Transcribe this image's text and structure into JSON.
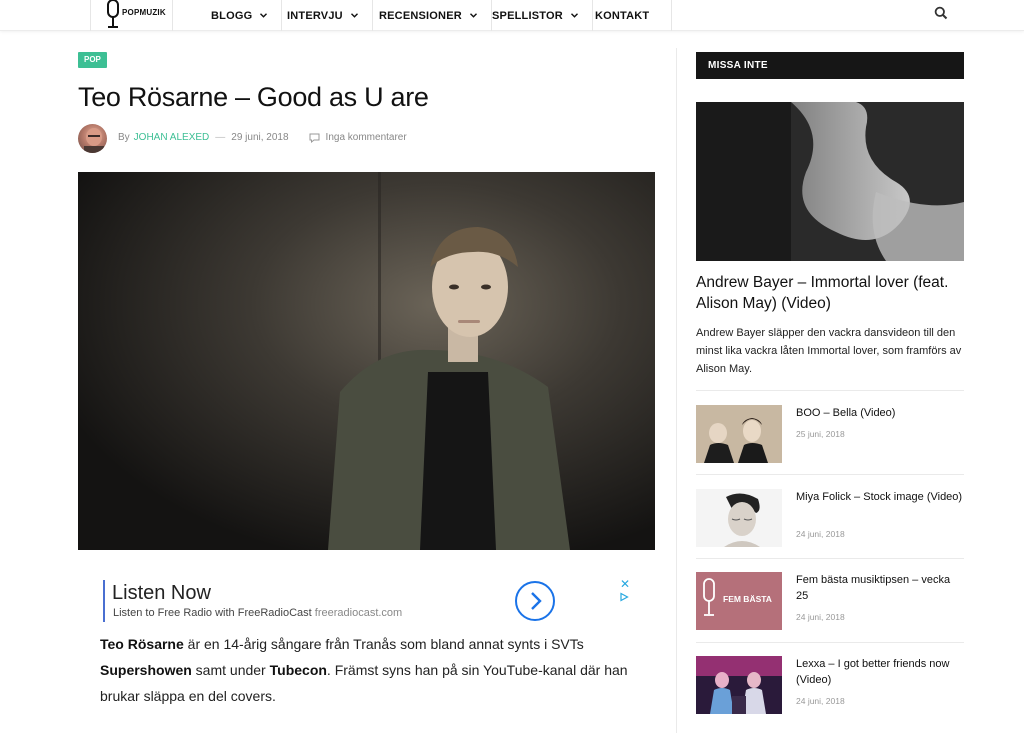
{
  "site": {
    "logo_text": "POPMUZIK"
  },
  "nav": {
    "items": [
      {
        "label": "BLOGG"
      },
      {
        "label": "INTERVJU"
      },
      {
        "label": "RECENSIONER"
      },
      {
        "label": "SPELLISTOR"
      },
      {
        "label": "KONTAKT"
      }
    ]
  },
  "article": {
    "category": "POP",
    "title": "Teo Rösarne – Good as U are",
    "by": "By",
    "author": "JOHAN ALEXED",
    "date": "29 juni, 2018",
    "comments": "Inga kommentarer",
    "body": {
      "s1_name": "Teo Rösarne",
      "s1_text": " är en 14-årig sångare från Tranås som bland annat synts i SVTs ",
      "s1_show": "Supershowen",
      "s1_mid": " samt under ",
      "s1_event": "Tubecon",
      "s1_end": ". Främst syns han på sin YouTube-kanal där han brukar släppa en del covers."
    }
  },
  "ad": {
    "title": "Listen Now",
    "subtitle": "Listen to Free Radio with FreeRadioCast",
    "domain": "freeradiocast.com",
    "close": "✕"
  },
  "sidebar": {
    "heading": "MISSA INTE",
    "featured": {
      "title": "Andrew Bayer – Immortal lover (feat. Alison May) (Video)",
      "description": "Andrew Bayer släpper den vackra dansvideon till den minst lika vackra låten Immortal lover, som framförs av Alison May."
    },
    "items": [
      {
        "title": "BOO – Bella (Video)",
        "date": "25 juni, 2018"
      },
      {
        "title": "Miya Folick – Stock image (Video)",
        "date": "24 juni, 2018"
      },
      {
        "title": "Fem bästa musiktipsen – vecka 25",
        "date": "24 juni, 2018",
        "thumb_text": "FEM BÄSTA"
      },
      {
        "title": "Lexxa – I got better friends now (Video)",
        "date": "24 juni, 2018"
      }
    ]
  },
  "colors": {
    "accent": "#3dbf94",
    "sidebar_heading_bg": "#161616",
    "fem_basta_bg": "#b5707a"
  }
}
